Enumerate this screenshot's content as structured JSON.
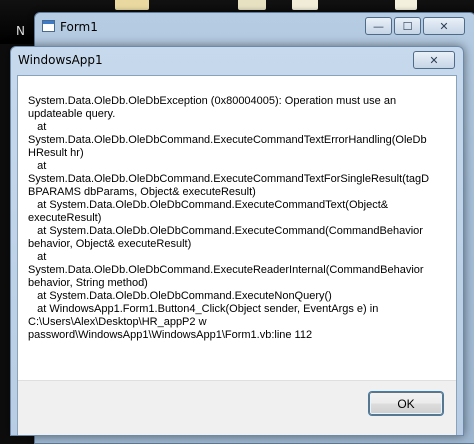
{
  "desktop": {
    "label": "N"
  },
  "form1": {
    "title": "Form1",
    "minimize_glyph": "—",
    "maximize_glyph": "☐",
    "close_glyph": "✕"
  },
  "dialog": {
    "title": "WindowsApp1",
    "close_glyph": "✕",
    "message": "System.Data.OleDb.OleDbException (0x80004005): Operation must use an\nupdateable query.\n   at\nSystem.Data.OleDb.OleDbCommand.ExecuteCommandTextErrorHandling(OleDb\nHResult hr)\n   at\nSystem.Data.OleDb.OleDbCommand.ExecuteCommandTextForSingleResult(tagD\nBPARAMS dbParams, Object& executeResult)\n   at System.Data.OleDb.OleDbCommand.ExecuteCommandText(Object&\nexecuteResult)\n   at System.Data.OleDb.OleDbCommand.ExecuteCommand(CommandBehavior\nbehavior, Object& executeResult)\n   at\nSystem.Data.OleDb.OleDbCommand.ExecuteReaderInternal(CommandBehavior\nbehavior, String method)\n   at System.Data.OleDb.OleDbCommand.ExecuteNonQuery()\n   at WindowsApp1.Form1.Button4_Click(Object sender, EventArgs e) in\nC:\\Users\\Alex\\Desktop\\HR_appP2 w\npassword\\WindowsApp1\\WindowsApp1\\Form1.vb:line 112",
    "ok_label": "OK"
  }
}
